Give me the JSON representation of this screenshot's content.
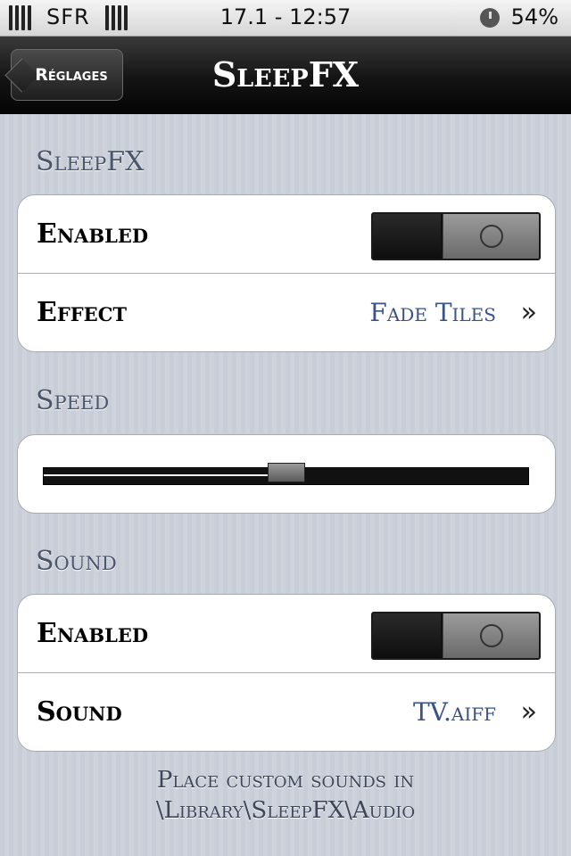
{
  "status_bar": {
    "carrier": "SFR",
    "date_time": "17.1 - 12:57",
    "battery": "54%",
    "icons": [
      "signal-bars-icon",
      "signal-bars-icon",
      "clock-icon"
    ]
  },
  "nav": {
    "back_label": "Réglages",
    "title": "SleepFX"
  },
  "sections": {
    "sleepfx": {
      "header": "SleepFX",
      "enabled_label": "Enabled",
      "enabled_on": true,
      "effect_label": "Effect",
      "effect_value": "Fade Tiles"
    },
    "speed": {
      "header": "Speed",
      "level": 0.5
    },
    "sound": {
      "header": "Sound",
      "enabled_label": "Enabled",
      "enabled_on": true,
      "sound_label": "Sound",
      "sound_value": "TV.aiff"
    }
  },
  "footer": {
    "line1": "Place custom sounds in",
    "line2": "\\Library\\SleepFX\\Audio"
  },
  "colors": {
    "value_text": "#3a5285",
    "header_text": "#4c566a",
    "background": "#c7ccd6"
  }
}
